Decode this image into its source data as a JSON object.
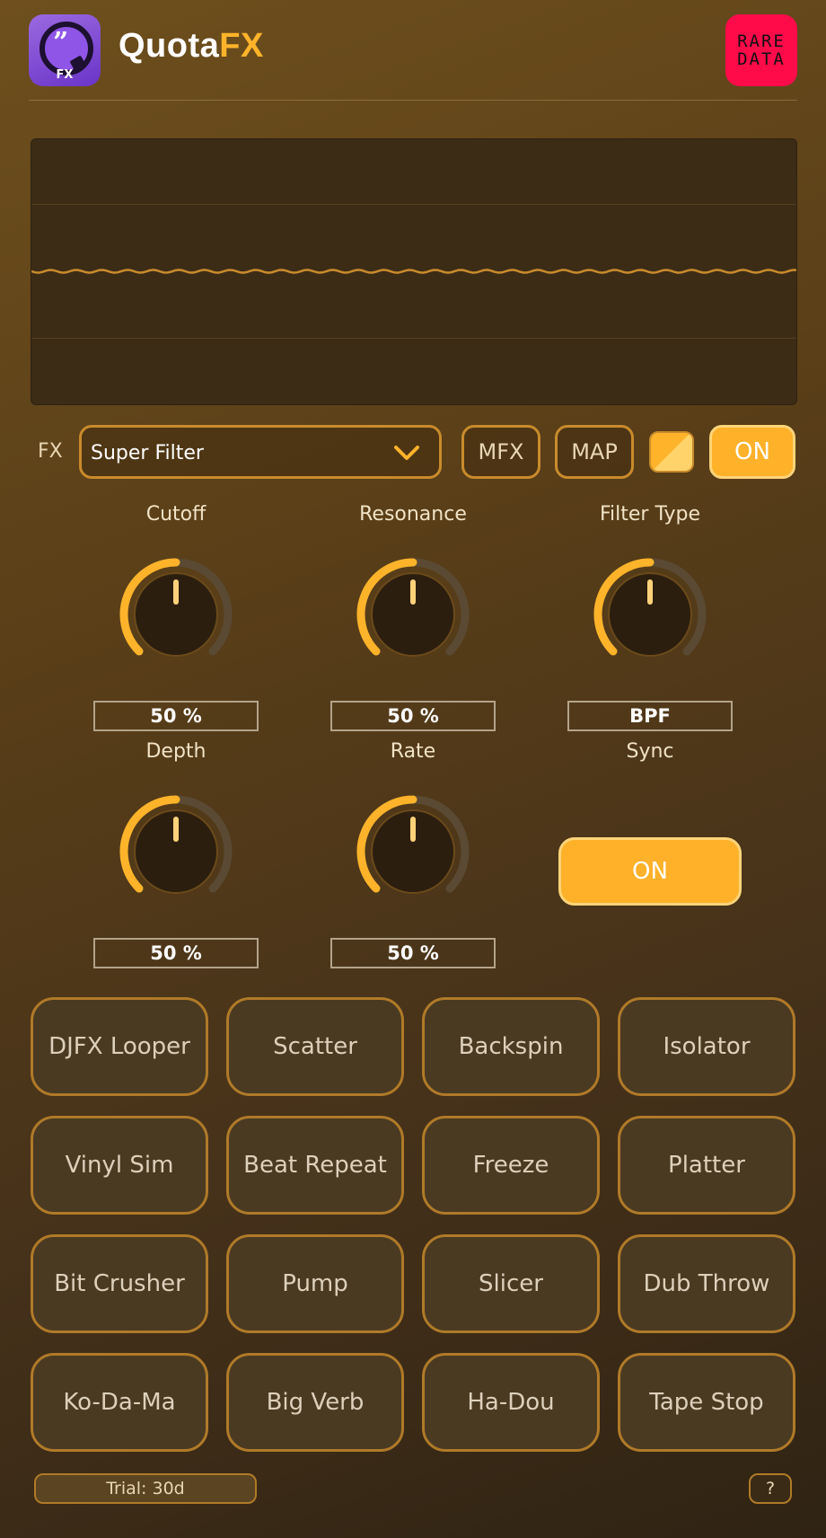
{
  "header": {
    "app_icon_label": "FX",
    "brand_part1": "Quota",
    "brand_part2": "FX",
    "partner_logo_line1": "RARE",
    "partner_logo_line2": "DATA"
  },
  "fx_bar": {
    "label": "FX",
    "selected_effect": "Super Filter",
    "mfx_label": "MFX",
    "map_label": "MAP",
    "on_label": "ON"
  },
  "knobs": {
    "cutoff": {
      "title": "Cutoff",
      "value": "50 %",
      "level": 0.5
    },
    "resonance": {
      "title": "Resonance",
      "value": "50 %",
      "level": 0.5
    },
    "filter_type": {
      "title": "Filter Type",
      "value": "BPF",
      "level": 0.5
    },
    "depth": {
      "title": "Depth",
      "value": "50 %",
      "level": 0.5
    },
    "rate": {
      "title": "Rate",
      "value": "50 %",
      "level": 0.5
    }
  },
  "sync": {
    "title": "Sync",
    "button_label": "ON"
  },
  "pads": [
    "DJFX Looper",
    "Scatter",
    "Backspin",
    "Isolator",
    "Vinyl Sim",
    "Beat Repeat",
    "Freeze",
    "Platter",
    "Bit Crusher",
    "Pump",
    "Slicer",
    "Dub Throw",
    "Ko-Da-Ma",
    "Big Verb",
    "Ha-Dou",
    "Tape Stop"
  ],
  "footer": {
    "trial": "Trial: 30d",
    "help": "?"
  },
  "colors": {
    "accent": "#ffb32a",
    "pad_border": "#b07a28",
    "partner_logo_bg": "#ff0b4a"
  }
}
